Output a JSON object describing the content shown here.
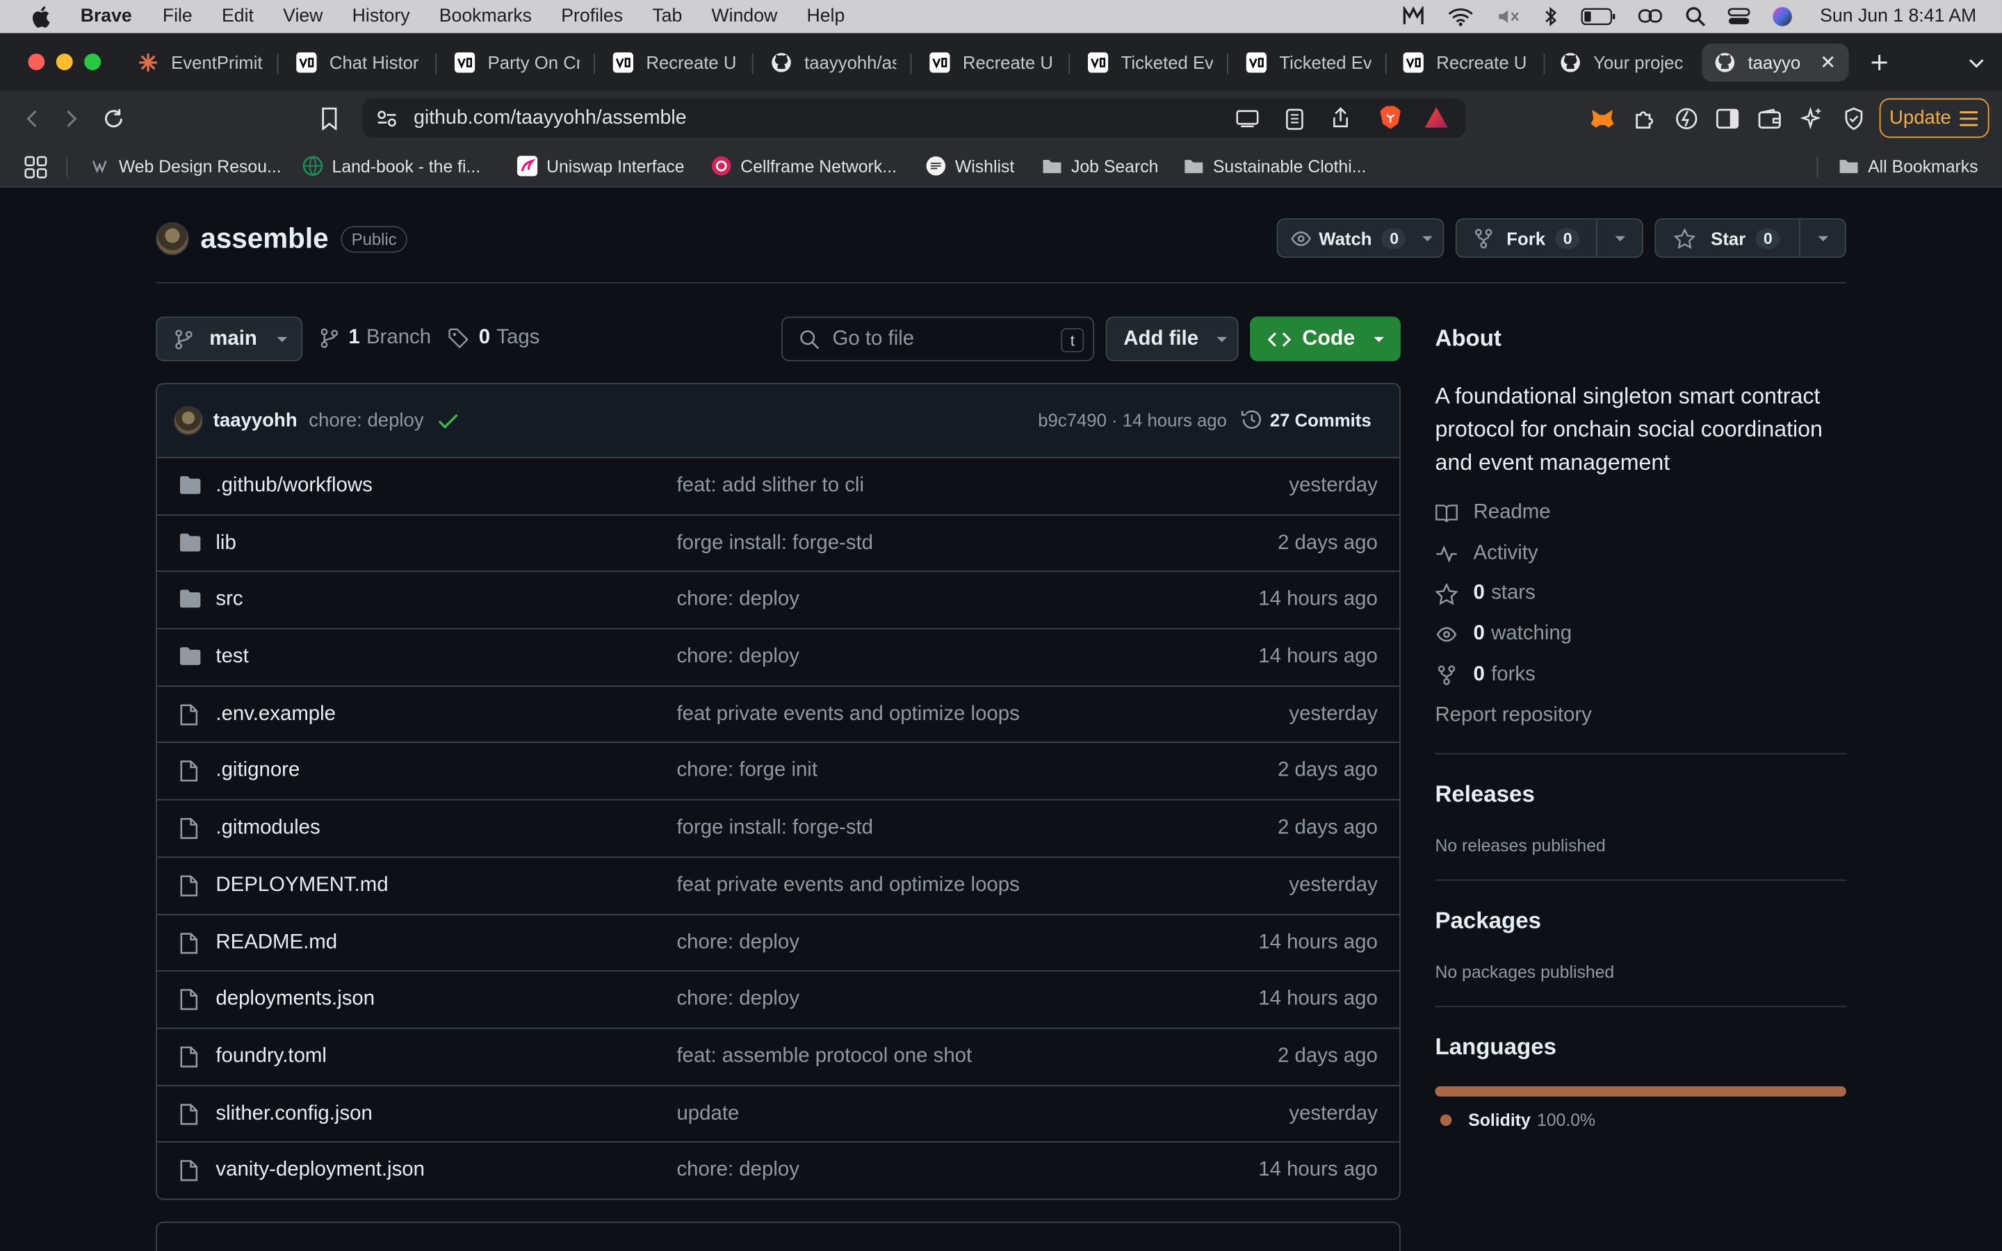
{
  "menubar": {
    "app": "Brave",
    "items": [
      "File",
      "Edit",
      "View",
      "History",
      "Bookmarks",
      "Profiles",
      "Tab",
      "Window",
      "Help"
    ],
    "datetime": "Sun Jun 1  8:41 AM"
  },
  "tabs": [
    {
      "title": "EventPrimit",
      "icon": "sparkle-icon"
    },
    {
      "title": "Chat Histor",
      "icon": "v0-icon"
    },
    {
      "title": "Party On Cr",
      "icon": "v0-icon"
    },
    {
      "title": "Recreate U",
      "icon": "v0-icon"
    },
    {
      "title": "taayyohh/as",
      "icon": "github-icon"
    },
    {
      "title": "Recreate U",
      "icon": "v0-icon"
    },
    {
      "title": "Ticketed Ev",
      "icon": "v0-icon"
    },
    {
      "title": "Ticketed Ev",
      "icon": "v0-icon"
    },
    {
      "title": "Recreate U",
      "icon": "v0-icon"
    },
    {
      "title": "Your projec",
      "icon": "github-icon"
    },
    {
      "title": "taayyoh",
      "icon": "github-icon"
    }
  ],
  "address": {
    "url": "github.com/taayyohh/assemble",
    "update_label": "Update"
  },
  "bookmarks": [
    {
      "label": "Web Design Resou...",
      "icon": "web-icon"
    },
    {
      "label": "Land-book - the fi...",
      "icon": "globe-icon"
    },
    {
      "label": "Uniswap Interface",
      "icon": "uniswap-icon"
    },
    {
      "label": "Cellframe Network...",
      "icon": "cellframe-icon"
    },
    {
      "label": "Wishlist",
      "icon": "wishlist-icon"
    },
    {
      "label": "Job Search",
      "icon": "folder-icon"
    },
    {
      "label": "Sustainable Clothi...",
      "icon": "folder-icon"
    }
  ],
  "all_bookmarks": "All Bookmarks",
  "repo": {
    "name": "assemble",
    "visibility": "Public",
    "watch_label": "Watch",
    "watch_count": "0",
    "fork_label": "Fork",
    "fork_count": "0",
    "star_label": "Star",
    "star_count": "0",
    "branch": "main",
    "branches_count": "1",
    "branches_label": "Branch",
    "tags_count": "0",
    "tags_label": "Tags",
    "goto_placeholder": "Go to file",
    "goto_kbd": "t",
    "add_file": "Add file",
    "code": "Code"
  },
  "commit": {
    "author": "taayyohh",
    "message": "chore: deploy",
    "sha_time": "b9c7490 · 14 hours ago",
    "commits": "27 Commits"
  },
  "files": [
    {
      "type": "dir",
      "name": ".github/workflows",
      "message": "feat: add slither to cli",
      "date": "yesterday"
    },
    {
      "type": "dir",
      "name": "lib",
      "message": "forge install: forge-std",
      "date": "2 days ago"
    },
    {
      "type": "dir",
      "name": "src",
      "message": "chore: deploy",
      "date": "14 hours ago"
    },
    {
      "type": "dir",
      "name": "test",
      "message": "chore: deploy",
      "date": "14 hours ago"
    },
    {
      "type": "file",
      "name": ".env.example",
      "message": "feat private events and optimize loops",
      "date": "yesterday"
    },
    {
      "type": "file",
      "name": ".gitignore",
      "message": "chore: forge init",
      "date": "2 days ago"
    },
    {
      "type": "file",
      "name": ".gitmodules",
      "message": "forge install: forge-std",
      "date": "2 days ago"
    },
    {
      "type": "file",
      "name": "DEPLOYMENT.md",
      "message": "feat private events and optimize loops",
      "date": "yesterday"
    },
    {
      "type": "file",
      "name": "README.md",
      "message": "chore: deploy",
      "date": "14 hours ago"
    },
    {
      "type": "file",
      "name": "deployments.json",
      "message": "chore: deploy",
      "date": "14 hours ago"
    },
    {
      "type": "file",
      "name": "foundry.toml",
      "message": "feat: assemble protocol one shot",
      "date": "2 days ago"
    },
    {
      "type": "file",
      "name": "slither.config.json",
      "message": "update",
      "date": "yesterday"
    },
    {
      "type": "file",
      "name": "vanity-deployment.json",
      "message": "chore: deploy",
      "date": "14 hours ago"
    }
  ],
  "about": {
    "heading": "About",
    "description": "A foundational singleton smart contract protocol for onchain social coordination and event management",
    "readme": "Readme",
    "activity": "Activity",
    "stars_count": "0",
    "stars_label": "stars",
    "watching_count": "0",
    "watching_label": "watching",
    "forks_count": "0",
    "forks_label": "forks",
    "report": "Report repository"
  },
  "releases": {
    "heading": "Releases",
    "empty": "No releases published"
  },
  "packages": {
    "heading": "Packages",
    "empty": "No packages published"
  },
  "languages": {
    "heading": "Languages",
    "items": [
      {
        "name": "Solidity",
        "percent": "100.0%",
        "fraction": 1.0
      }
    ]
  },
  "colors": {
    "accent_green": "#238636",
    "solidity": "#aa6746",
    "update_orange": "#e8a23a"
  }
}
